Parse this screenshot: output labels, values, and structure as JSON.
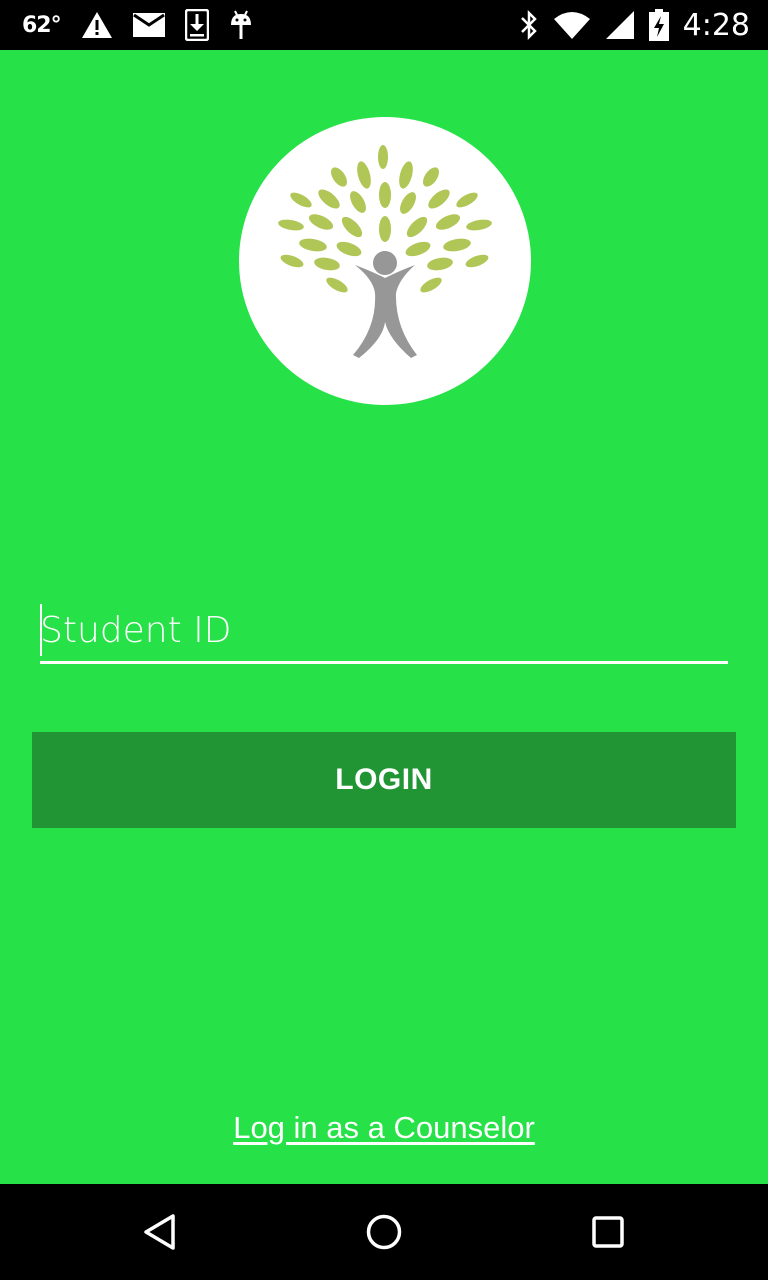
{
  "status_bar": {
    "temperature": "62°",
    "time": "4:28",
    "left_icons": [
      "warning-icon",
      "mail-icon",
      "download-icon",
      "android-icon"
    ],
    "right_icons": [
      "bluetooth-icon",
      "wifi-icon",
      "cell-signal-icon",
      "battery-charging-icon"
    ]
  },
  "logo": {
    "icon": "tree-person-logo-icon",
    "leaf_color": "#b0c656",
    "figure_color": "#979797"
  },
  "login_form": {
    "student_id_placeholder": "Student ID",
    "login_label": "LOGIN",
    "counselor_link": "Log in as a Counselor"
  },
  "nav_bar": {
    "buttons": [
      "back-icon",
      "home-icon",
      "recents-icon"
    ]
  },
  "colors": {
    "background": "#26e147",
    "button": "#219533",
    "text": "#ffffff"
  }
}
